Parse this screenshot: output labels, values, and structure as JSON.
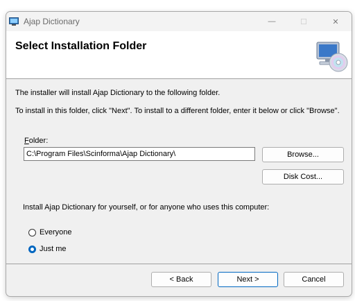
{
  "window": {
    "title": "Ajap Dictionary",
    "controls": {
      "minimize": "—",
      "maximize": "☐",
      "close": "✕"
    }
  },
  "header": {
    "title": "Select Installation Folder"
  },
  "body": {
    "line1": "The installer will install Ajap Dictionary to the following folder.",
    "line2": "To install in this folder, click \"Next\". To install to a different folder, enter it below or click \"Browse\".",
    "folder_label_accel": "F",
    "folder_label_rest": "older:",
    "folder_value": "C:\\Program Files\\Scinforma\\Ajap Dictionary\\",
    "browse_label": "Browse...",
    "disk_cost_label": "Disk Cost...",
    "scope_prompt": "Install Ajap Dictionary for yourself, or for anyone who uses this computer:",
    "options": [
      {
        "label": "Everyone",
        "checked": false
      },
      {
        "label": "Just me",
        "checked": true
      }
    ]
  },
  "footer": {
    "back_label": "< Back",
    "next_label": "Next >",
    "cancel_label": "Cancel"
  },
  "colors": {
    "accent": "#0067c0",
    "dialog_bg": "#f0f0f0",
    "header_bg": "#ffffff"
  }
}
